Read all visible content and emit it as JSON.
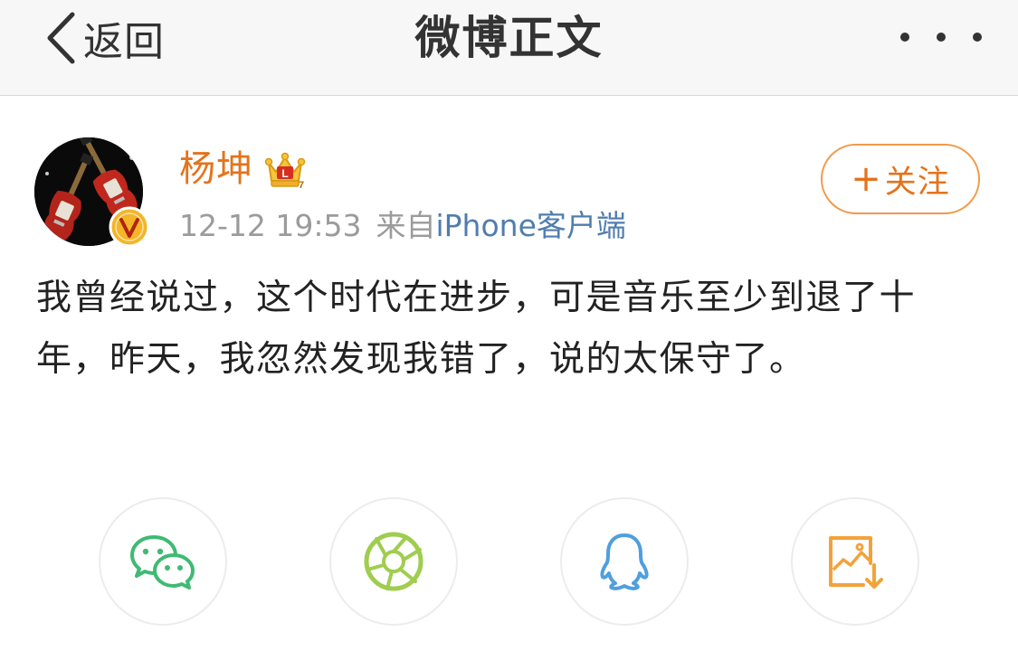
{
  "nav": {
    "back_label": "返回",
    "title": "微博正文"
  },
  "post": {
    "user_name": "杨坤",
    "timestamp": "12-12 19:53",
    "source_prefix": "来自",
    "source_name": "iPhone客户端",
    "follow_label": "关注",
    "follow_plus": "+",
    "text": "我曾经说过，这个时代在进步，可是音乐至少到退了十年，昨天，我忽然发现我错了，说的太保守了。"
  },
  "share": {
    "items": [
      {
        "icon": "wechat-icon",
        "color": "#3fba73"
      },
      {
        "icon": "moments-icon",
        "color": "#9fcd4f"
      },
      {
        "icon": "qq-icon",
        "color": "#4f9fde"
      },
      {
        "icon": "save-image-icon",
        "color": "#f2a23b"
      }
    ]
  },
  "colors": {
    "accent": "#e4731b",
    "link": "#507daf",
    "muted": "#9b9b9b",
    "navbar_bg": "#f7f7f7"
  }
}
